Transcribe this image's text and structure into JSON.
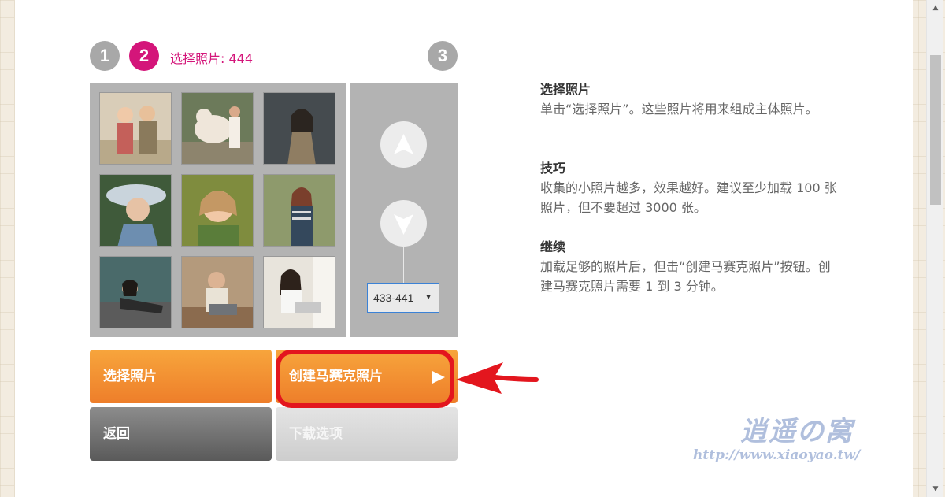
{
  "steps": {
    "step1": "1",
    "step2": "2",
    "step3": "3",
    "current_caption": "选择照片: 444"
  },
  "photo_grid": {
    "photos": [
      {
        "alt": "two children"
      },
      {
        "alt": "woman with white tiger"
      },
      {
        "alt": "woman in rain"
      },
      {
        "alt": "girl in hat"
      },
      {
        "alt": "smiling child"
      },
      {
        "alt": "woman in park"
      },
      {
        "alt": "woman reclining"
      },
      {
        "alt": "woman with laptop"
      },
      {
        "alt": "woman with laptop at window"
      }
    ]
  },
  "navigator": {
    "up_icon": "arrow-up-icon",
    "down_icon": "arrow-down-icon",
    "range_select": "433-441"
  },
  "buttons": {
    "select_photos": "选择照片",
    "create_mosaic": "创建马赛克照片",
    "back": "返回",
    "download_options": "下载选项"
  },
  "info": {
    "section1_title": "选择照片",
    "section1_body": "单击“选择照片”。这些照片将用来组成主体照片。",
    "section2_title": "技巧",
    "section2_body": "收集的小照片越多，效果越好。建议至少加载 100 张照片，但不要超过 3000 张。",
    "section3_title": "继续",
    "section3_body": "加载足够的照片后，但击“创建马赛克照片”按钮。创建马赛克照片需要 1 到 3 分钟。"
  },
  "watermark": {
    "logo": "逍遥の窝",
    "url": "http://www.xiaoyao.tw/"
  },
  "colors": {
    "accent": "#d4157a",
    "orange": "#f39234",
    "highlight": "#e3161e"
  }
}
